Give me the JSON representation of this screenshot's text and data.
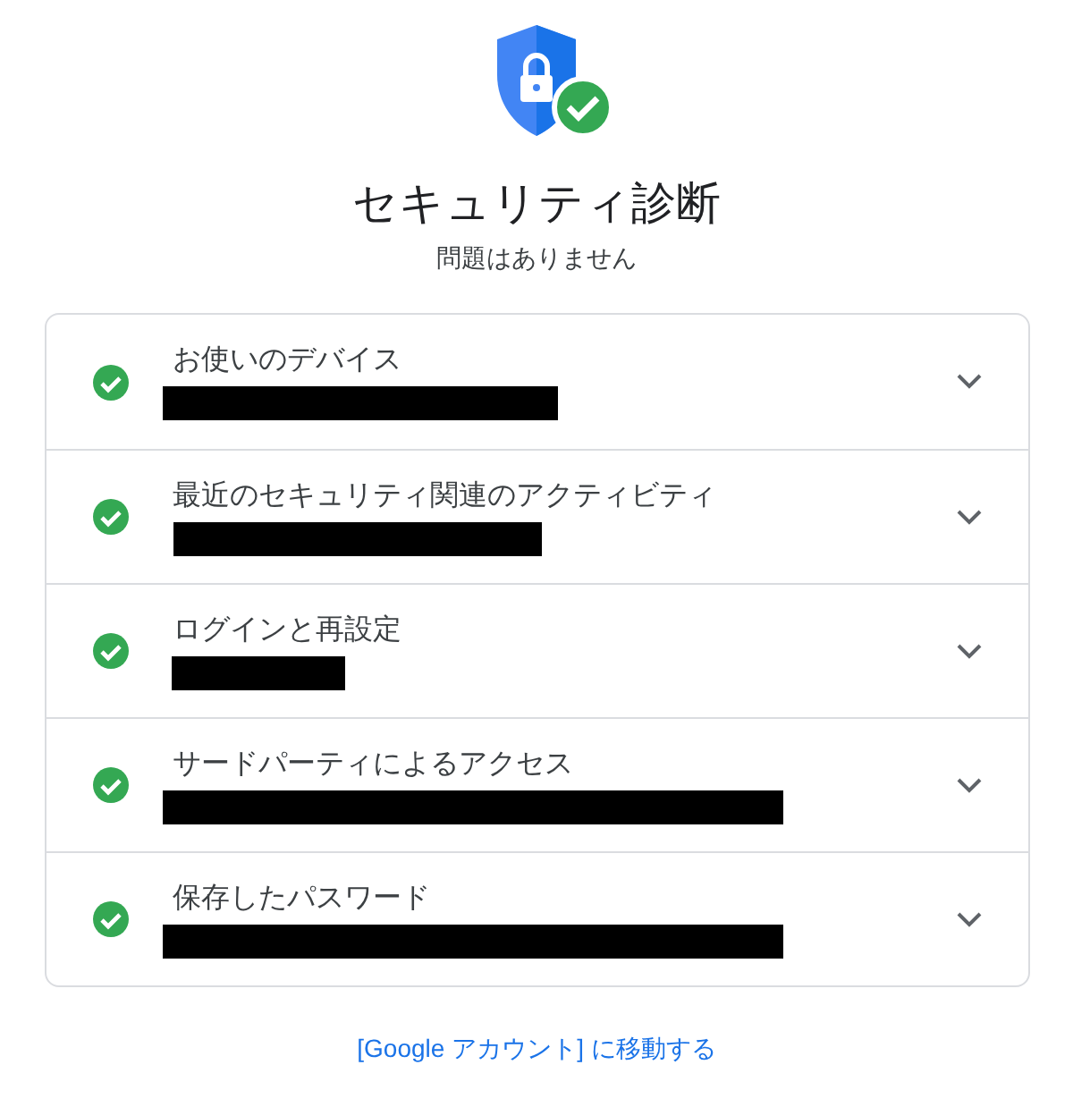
{
  "header": {
    "title": "セキュリティ診断",
    "subtitle": "問題はありません"
  },
  "items": [
    {
      "label": "お使いのデバイス",
      "kind": "passed",
      "expanded": false
    },
    {
      "label": "最近のセキュリティ関連のアクティビティ",
      "kind": "passed",
      "expanded": false
    },
    {
      "label": "ログインと再設定",
      "kind": "passed",
      "expanded": false
    },
    {
      "label": "サードパーティによるアクセス",
      "kind": "passed",
      "expanded": false
    },
    {
      "label": "保存したパスワード",
      "kind": "passed",
      "expanded": false
    }
  ],
  "footer_link": "[Google アカウント] に移動する"
}
